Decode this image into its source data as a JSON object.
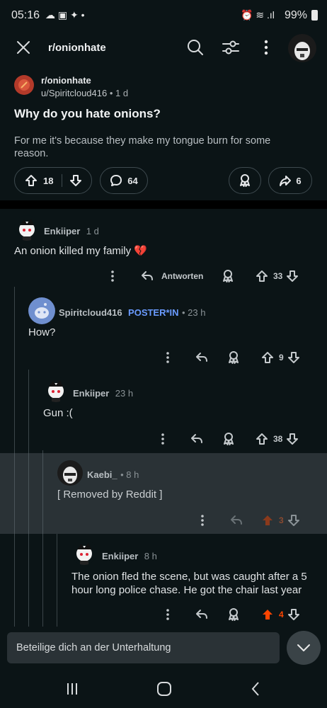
{
  "status": {
    "time": "05:16",
    "battery": "99%"
  },
  "header": {
    "subreddit": "r/onionhate"
  },
  "post": {
    "subreddit": "r/onionhate",
    "author": "u/Spiritcloud416",
    "age": "1 d",
    "title": "Why do you hate onions?",
    "body": "For me it's because they make my tongue burn for some reason.",
    "upvotes": "18",
    "comments": "64",
    "shares": "6"
  },
  "comments": [
    {
      "author": "Enkiiper",
      "age": "1 d",
      "text": "An onion killed my family 💔",
      "reply_label": "Antworten",
      "votes": "33"
    },
    {
      "author": "Spiritcloud416",
      "flair": "POSTER*IN",
      "age": "23 h",
      "text": "How?",
      "votes": "9"
    },
    {
      "author": "Enkiiper",
      "age": "23 h",
      "text": "Gun :(",
      "votes": "38"
    },
    {
      "author": "Kaebi_",
      "age": "8 h",
      "text": "[ Removed by Reddit ]",
      "votes": "3"
    },
    {
      "author": "Enkiiper",
      "age": "8 h",
      "text": "The onion fled the scene, but was caught after a 5 hour long police chase. He got the chair last year",
      "votes": "4"
    }
  ],
  "composer": {
    "placeholder": "Beteilige dich an der Unterhaltung"
  },
  "colors": {
    "background": "#0b1416",
    "upvote_active": "#ff4500",
    "flair": "#6a9bff",
    "removed_bg": "#2a3236"
  }
}
